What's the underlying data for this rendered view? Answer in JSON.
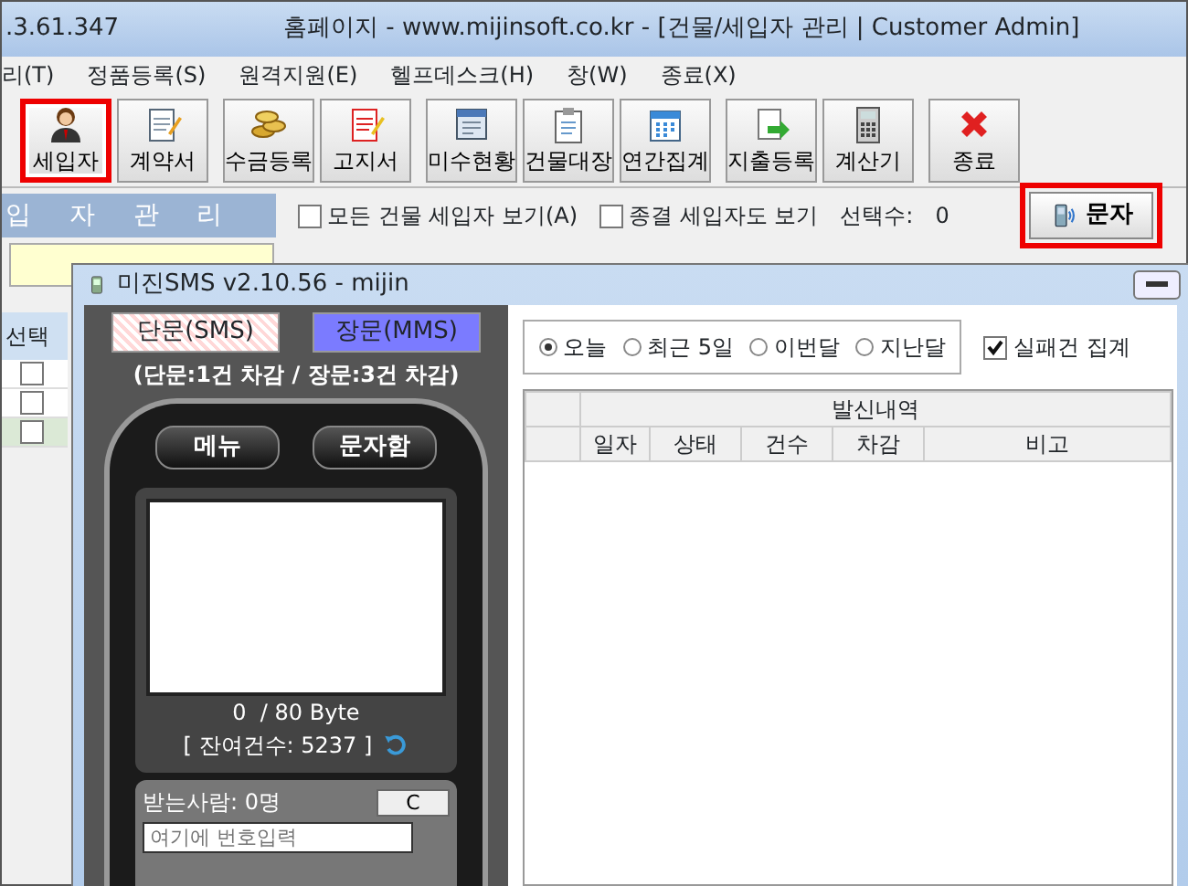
{
  "app": {
    "title_prefix": ".3.61.347",
    "title": "홈페이지 - www.mijinsoft.co.kr - [건물/세입자 관리  |  Customer Admin]"
  },
  "menu": [
    "리(T)",
    "정품등록(S)",
    "원격지원(E)",
    "헬프데스크(H)",
    "창(W)",
    "종료(X)"
  ],
  "toolbar": [
    [
      {
        "label": "세입자",
        "kind": "person",
        "highlighted": true
      },
      {
        "label": "계약서",
        "kind": "notepad",
        "highlighted": false
      }
    ],
    [
      {
        "label": "수금등록",
        "kind": "coins",
        "highlighted": false
      },
      {
        "label": "고지서",
        "kind": "notice",
        "highlighted": false
      }
    ],
    [
      {
        "label": "미수현황",
        "kind": "chart",
        "highlighted": false
      },
      {
        "label": "건물대장",
        "kind": "clipboard",
        "highlighted": false
      },
      {
        "label": "연간집계",
        "kind": "calendar",
        "highlighted": false
      }
    ],
    [
      {
        "label": "지출등록",
        "kind": "export",
        "highlighted": false
      },
      {
        "label": "계산기",
        "kind": "calculator",
        "highlighted": false
      }
    ],
    [
      {
        "label": "종료",
        "kind": "close",
        "highlighted": false
      }
    ]
  ],
  "filter_bar": {
    "banner": "입  자  관  리",
    "checkboxes": [
      {
        "label": "모든 건물 세입자 보기(A)",
        "checked": false
      },
      {
        "label": "종결 세입자도 보기",
        "checked": false
      }
    ],
    "count_label": "선택수:",
    "count": "0",
    "sms_button": {
      "label": "문자",
      "highlighted": true
    }
  },
  "grid": {
    "header": "선택",
    "rows": [
      {
        "checked": false,
        "selected": false
      },
      {
        "checked": false,
        "selected": false
      },
      {
        "checked": false,
        "selected": true
      }
    ]
  },
  "sms_window": {
    "title": "미진SMS v2.10.56 - mijin",
    "mode_tabs": [
      {
        "label": "단문(SMS)",
        "selected": false
      },
      {
        "label": "장문(MMS)",
        "selected": true
      }
    ],
    "note": "(단문:1건 차감 / 장문:3건 차감)",
    "phone_buttons": [
      "메뉴",
      "문자함"
    ],
    "byte_count": "0  / 80 Byte",
    "remaining": "[ 잔여건수: 5237 ]",
    "recipients_label": "받는사람: 0명",
    "clear_button": "C",
    "number_placeholder": "여기에 번호입력",
    "periods": [
      {
        "label": "오늘",
        "selected": true
      },
      {
        "label": "최근 5일",
        "selected": false
      },
      {
        "label": "이번달",
        "selected": false
      },
      {
        "label": "지난달",
        "selected": false
      }
    ],
    "failed_checkbox": {
      "label": "실패건 집계",
      "checked": true
    },
    "table": {
      "group_header": "발신내역",
      "columns": [
        "일자",
        "상태",
        "건수",
        "차감",
        "비고"
      ]
    }
  }
}
